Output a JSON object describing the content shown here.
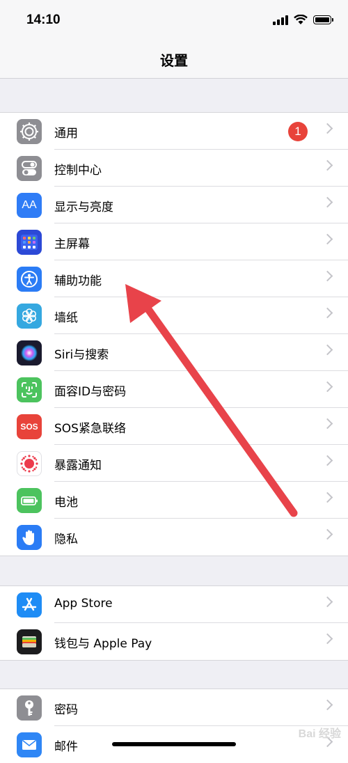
{
  "status_bar": {
    "time": "14:10"
  },
  "nav": {
    "title": "设置"
  },
  "groups": [
    {
      "items": [
        {
          "label": "通用",
          "icon": "gear-icon",
          "color": "#8e8e93",
          "badge": "1"
        },
        {
          "label": "控制中心",
          "icon": "toggles-icon",
          "color": "#8e8e93"
        },
        {
          "label": "显示与亮度",
          "icon": "text-size-icon",
          "color": "#2f7cf6",
          "icon_text": "AA"
        },
        {
          "label": "主屏幕",
          "icon": "home-grid-icon",
          "color": "#2c49d6"
        },
        {
          "label": "辅助功能",
          "icon": "accessibility-icon",
          "color": "#2b7cf5"
        },
        {
          "label": "墙纸",
          "icon": "flower-icon",
          "color": "#35a8e0"
        },
        {
          "label": "Siri与搜索",
          "icon": "siri-icon",
          "color": "#1a1a2e"
        },
        {
          "label": "面容ID与密码",
          "icon": "face-id-icon",
          "color": "#4cc35e"
        },
        {
          "label": "SOS紧急联络",
          "icon": "sos-icon",
          "color": "#e8433a",
          "icon_text": "SOS"
        },
        {
          "label": "暴露通知",
          "icon": "exposure-icon",
          "color": "#ffffff"
        },
        {
          "label": "电池",
          "icon": "battery-icon",
          "color": "#4cc35e"
        },
        {
          "label": "隐私",
          "icon": "hand-icon",
          "color": "#2b7cf5"
        }
      ]
    },
    {
      "items": [
        {
          "label": "App Store",
          "icon": "app-store-icon",
          "color": "#1e8cf5"
        },
        {
          "label": "钱包与 Apple Pay",
          "icon": "wallet-icon",
          "color": "#1c1c1e"
        }
      ]
    },
    {
      "items": [
        {
          "label": "密码",
          "icon": "key-icon",
          "color": "#8e8e93"
        },
        {
          "label": "邮件",
          "icon": "mail-icon",
          "color": "#2f86f5"
        }
      ]
    }
  ],
  "annotation": {
    "arrow_color": "#e8434a"
  },
  "watermark": "Bai 经验"
}
